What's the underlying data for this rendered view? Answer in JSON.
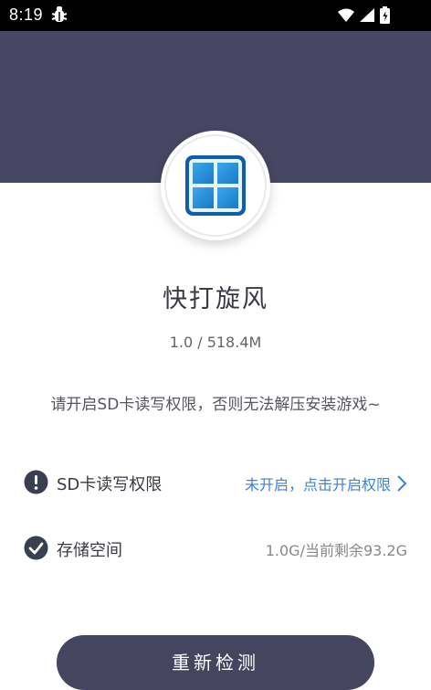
{
  "status_bar": {
    "time": "8:19",
    "icons": [
      "bug-icon",
      "wifi-icon",
      "signal-icon",
      "battery-charging-icon"
    ]
  },
  "app": {
    "name": "快打旋风",
    "version_size": "1.0 / 518.4M",
    "icon": "windows-tile-icon"
  },
  "hint": "请开启SD卡读写权限，否则无法解压安装游戏~",
  "rows": [
    {
      "icon": "exclamation-circle-icon",
      "label": "SD卡读写权限",
      "value": "未开启，点击开启权限",
      "action_icon": "chevron-right-icon"
    },
    {
      "icon": "check-circle-icon",
      "label": "存储空间",
      "value": "1.0G/当前剩余93.2G"
    }
  ],
  "button": {
    "label": "重新检测"
  },
  "colors": {
    "header": "#474763",
    "link": "#3d82d4",
    "button": "#454560"
  }
}
